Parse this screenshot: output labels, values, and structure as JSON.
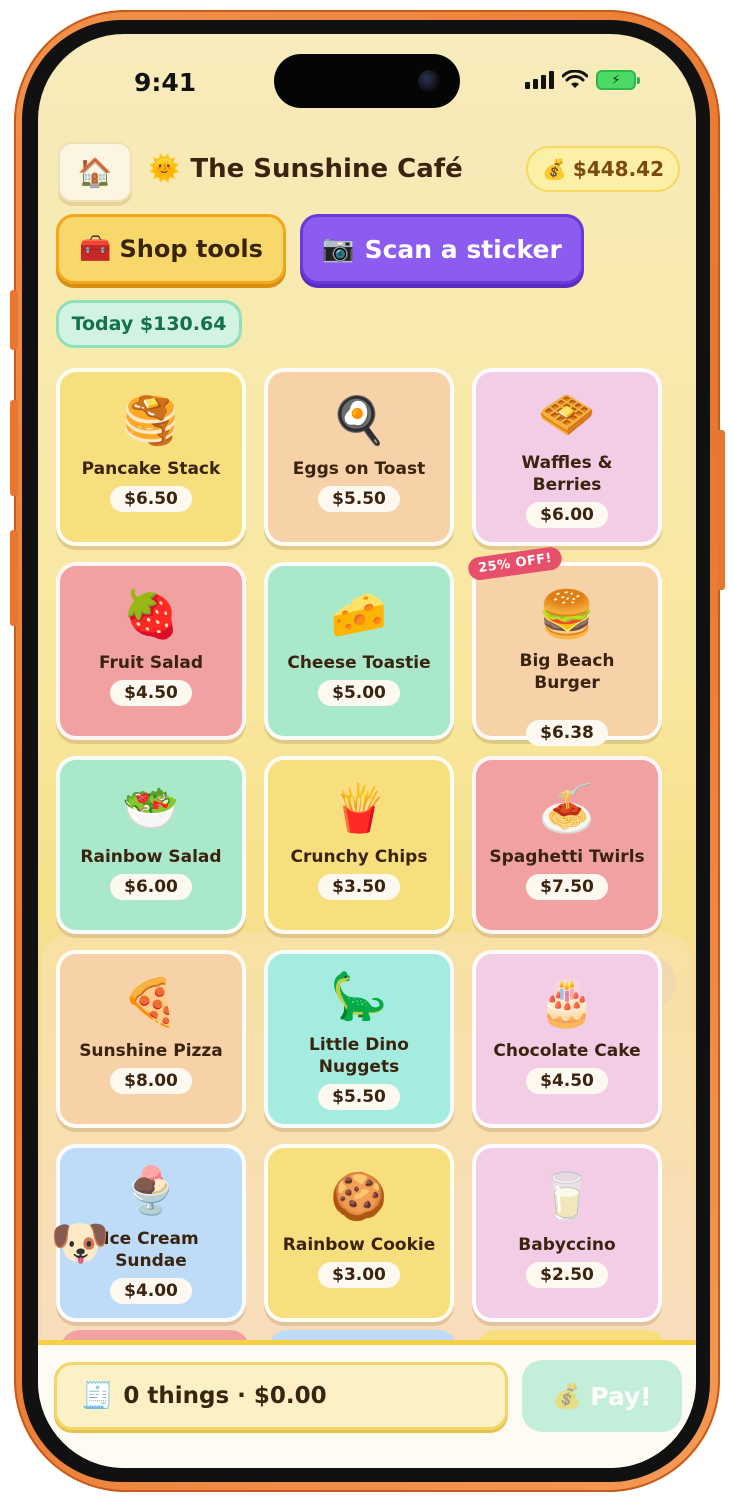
{
  "status": {
    "time": "9:41"
  },
  "header": {
    "home_icon": "house-icon",
    "title_icon": "sun-icon",
    "title": "The Sunshine Café",
    "balance_icon": "money-bag-icon",
    "balance": "$448.42"
  },
  "actions": {
    "shop_tools": "Shop tools",
    "scan_sticker": "Scan a sticker"
  },
  "today": "Today $130.64",
  "menu": [
    {
      "name": "Pancake Stack",
      "price": "$6.50",
      "emoji": "🥞"
    },
    {
      "name": "Eggs on Toast",
      "price": "$5.50",
      "emoji": "🍳"
    },
    {
      "name": "Waffles & Berries",
      "price": "$6.00",
      "emoji": "🧇"
    },
    {
      "name": "Fruit Salad",
      "price": "$4.50",
      "emoji": "🍓"
    },
    {
      "name": "Cheese Toastie",
      "price": "$5.00",
      "emoji": "🧀"
    },
    {
      "name": "Big Beach Burger",
      "price": "$6.38",
      "emoji": "🍔",
      "badge": "25% OFF!"
    },
    {
      "name": "Rainbow Salad",
      "price": "$6.00",
      "emoji": "🥗"
    },
    {
      "name": "Crunchy Chips",
      "price": "$3.50",
      "emoji": "🍟"
    },
    {
      "name": "Spaghetti Twirls",
      "price": "$7.50",
      "emoji": "🍝"
    },
    {
      "name": "Sunshine Pizza",
      "price": "$8.00",
      "emoji": "🍕"
    },
    {
      "name": "Little Dino Nuggets",
      "price": "$5.50",
      "emoji": "🦕"
    },
    {
      "name": "Chocolate Cake",
      "price": "$4.50",
      "emoji": "🎂"
    },
    {
      "name": "Ice Cream Sundae",
      "price": "$4.00",
      "emoji": "🍨"
    },
    {
      "name": "Rainbow Cookie",
      "price": "$3.00",
      "emoji": "🍪"
    },
    {
      "name": "Babyccino",
      "price": "$2.50",
      "emoji": "🥛"
    }
  ],
  "mascot": "dog-icon",
  "cart": {
    "icon": "receipt-icon",
    "summary": "0 things · $0.00"
  },
  "pay": {
    "label": "Pay!",
    "icon": "money-bag-icon"
  },
  "colors": {
    "accent_purple": "#8c5cf0",
    "accent_orange": "#f2a61a",
    "mint": "#a9e9ca",
    "phone_frame": "#e8762e"
  }
}
